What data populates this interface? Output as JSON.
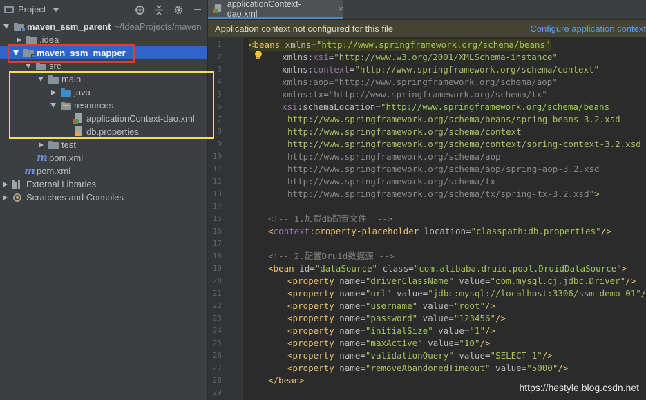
{
  "project_panel": {
    "title": "Project",
    "tree": [
      {
        "label": "maven_ssm_parent",
        "path": "~/IdeaProjects/maven",
        "icon": "module-folder-icon"
      },
      {
        "label": ".idea",
        "icon": "folder-icon"
      },
      {
        "label": "maven_ssm_mapper",
        "icon": "module-folder-icon"
      },
      {
        "label": "src",
        "icon": "folder-icon"
      },
      {
        "label": "main",
        "icon": "folder-icon"
      },
      {
        "label": "java",
        "icon": "source-folder-icon"
      },
      {
        "label": "resources",
        "icon": "resources-folder-icon"
      },
      {
        "label": "applicationContext-dao.xml",
        "icon": "spring-xml-icon"
      },
      {
        "label": "db.properties",
        "icon": "properties-file-icon"
      },
      {
        "label": "test",
        "icon": "folder-icon"
      },
      {
        "label": "pom.xml",
        "icon": "maven-icon"
      },
      {
        "label": "pom.xml",
        "icon": "maven-icon"
      },
      {
        "label": "External Libraries",
        "icon": "libraries-icon"
      },
      {
        "label": "Scratches and Consoles",
        "icon": "scratches-icon"
      }
    ]
  },
  "editor": {
    "tab_label": "applicationContext-dao.xml",
    "tab_close": "×",
    "banner_message": "Application context not configured for this file",
    "banner_link": "Configure application context",
    "line_numbers": [
      "1",
      "2",
      "3",
      "4",
      "5",
      "6",
      "7",
      "8",
      "9",
      "10",
      "11",
      "12",
      "13",
      "14",
      "15",
      "16",
      "17",
      "18",
      "19",
      "20",
      "21",
      "22",
      "23",
      "24",
      "25",
      "26",
      "27",
      "28",
      "29"
    ],
    "code": {
      "l1_tag": "<beans",
      "l1_att": " xmlns=",
      "l1_val": "\"http://www.springframework.org/schema/beans\"",
      "l2_att": "xmlns:",
      "l2_ns": "xsi",
      "l2_eq": "=",
      "l2_val": "\"http://www.w3.org/2001/XMLSchema-instance\"",
      "l3_att": "xmlns:",
      "l3_ns": "context",
      "l3_eq": "=",
      "l3_val": "\"http://www.springframework.org/schema/context\"",
      "l4": "xmlns:aop=\"http://www.springframework.org/schema/aop\"",
      "l5": "xmlns:tx=\"http://www.springframework.org/schema/tx\"",
      "l6_ns": "xsi",
      "l6_att": ":schemaLocation=",
      "l6_val": "\"http://www.springframework.org/schema/beans",
      "l7": "http://www.springframework.org/schema/beans/spring-beans-3.2.xsd",
      "l8": "http://www.springframework.org/schema/context",
      "l9": "http://www.springframework.org/schema/context/spring-context-3.2.xsd",
      "l10": "http://www.springframework.org/schema/aop",
      "l11": "http://www.springframework.org/schema/aop/spring-aop-3.2.xsd",
      "l12": "http://www.springframework.org/schema/tx",
      "l13": "http://www.springframework.org/schema/tx/spring-tx-3.2.xsd\"",
      "l13_close": ">",
      "l15": "<!-- 1.加载db配置文件  -->",
      "l16_tag": "<",
      "l16_ns": "context",
      "l16_tag2": ":property-placeholder",
      "l16_att": " location=",
      "l16_val": "\"classpath:db.properties\"",
      "l16_close": "/>",
      "l18": "<!-- 2.配置Druid数据源 -->",
      "l19_tag": "<bean",
      "l19_att1": " id=",
      "l19_val1": "\"dataSource\"",
      "l19_att2": " class=",
      "l19_val2": "\"com.alibaba.druid.pool.DruidDataSource\"",
      "l19_close": ">",
      "properties": [
        {
          "name": "\"driverClassName\"",
          "value": "\"com.mysql.cj.jdbc.Driver\""
        },
        {
          "name": "\"url\"",
          "value": "\"jdbc:mysql://localhost:3306/ssm_demo_01\""
        },
        {
          "name": "\"username\"",
          "value": "\"root\""
        },
        {
          "name": "\"password\"",
          "value": "\"123456\""
        },
        {
          "name": "\"initialSize\"",
          "value": "\"1\""
        },
        {
          "name": "\"maxActive\"",
          "value": "\"10\""
        },
        {
          "name": "\"validationQuery\"",
          "value": "\"SELECT 1\""
        },
        {
          "name": "\"removeAbandonedTimeout\"",
          "value": "\"5000\""
        }
      ],
      "prop_tag": "<property",
      "prop_name_att": " name=",
      "prop_value_att": " value=",
      "prop_close": "/>",
      "l28": "</bean>"
    }
  },
  "watermark": "https://hestyle.blog.csdn.net",
  "colors": {
    "selection": "#2f65ca",
    "red_marker": "#e53935",
    "yellow_marker": "#f4e04d",
    "tag": "#e8bf6a",
    "string": "#a5c25c",
    "namespace": "#9876aa",
    "link": "#589df6"
  }
}
